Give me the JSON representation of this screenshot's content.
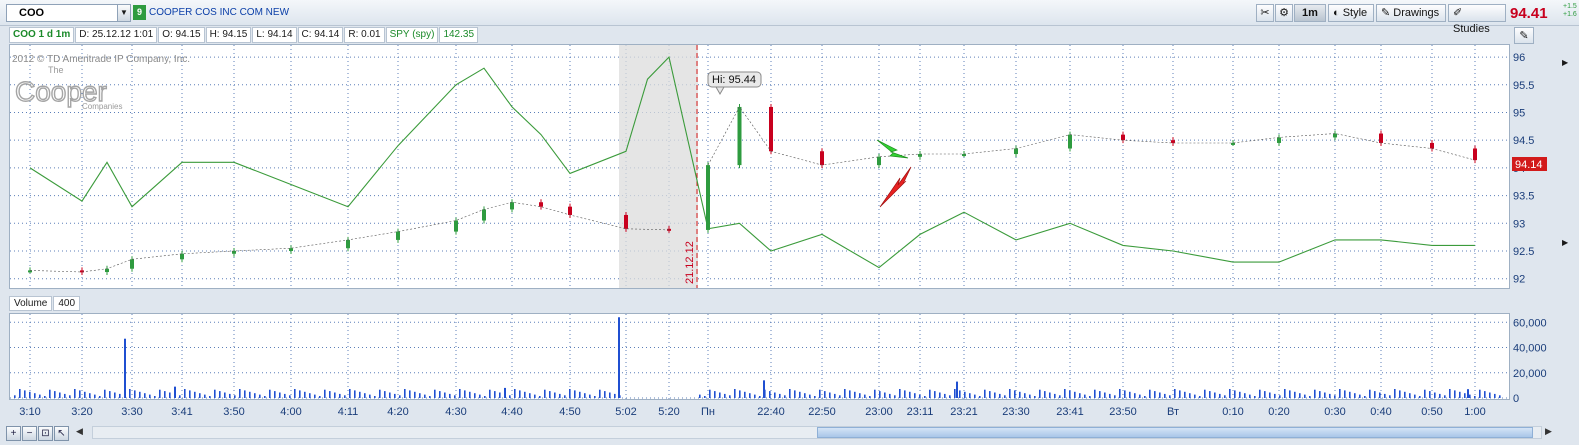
{
  "toolbar": {
    "symbol": "COO",
    "badge": "9",
    "company": "COOPER COS INC COM NEW",
    "buttons": {
      "period": "1m",
      "style": "Style",
      "drawings": "Drawings",
      "studies": "Studies"
    },
    "last_price": "94.41",
    "change_top": "+1.5",
    "change_bottom": "+1.6"
  },
  "info_bar": {
    "study": "COO 1 d 1m",
    "date": "D: 25.12.12 1:01",
    "open": "O: 94.15",
    "high": "H: 94.15",
    "low": "L: 94.14",
    "close": "C: 94.14",
    "range": "R: 0.01",
    "compare": "SPY (spy)",
    "compare_value": "142.35"
  },
  "watermark": {
    "copyright": "2012 © TD Ameritrade IP Company, Inc.",
    "logo_the": "The",
    "logo_main": "Cooper",
    "logo_sub": "Companies"
  },
  "volume_header": {
    "label": "Volume",
    "value": "400"
  },
  "colors": {
    "up": "#2e9b3f",
    "down": "#c8001e",
    "compare": "#3b9b3b",
    "volume": "#1f4fd1",
    "grid": "#5c7fb8"
  },
  "chart_data": [
    {
      "type": "candlestick",
      "title": "COO 1 d 1m",
      "ylim": [
        91.85,
        96.2
      ],
      "yticks": [
        92,
        92.5,
        93,
        93.5,
        94,
        94.5,
        95,
        95.5,
        96
      ],
      "grid": true,
      "x_ticks": [
        "3:10",
        "3:20",
        "3:30",
        "3:41",
        "3:50",
        "4:00",
        "4:11",
        "4:20",
        "4:30",
        "4:40",
        "4:50",
        "5:02",
        "5:20",
        "Пн",
        "22:40",
        "22:50",
        "23:00",
        "23:11",
        "23:21",
        "23:30",
        "23:41",
        "23:50",
        "Вт",
        "0:10",
        "0:20",
        "0:30",
        "0:40",
        "0:50",
        "1:00"
      ],
      "session_break_label": "21.12.12",
      "high_label": "Hi: 95.44",
      "last_marker": "94.14",
      "series": [
        {
          "name": "COO",
          "points": [
            [
              "3:10",
              92.15
            ],
            [
              "3:20",
              92.12
            ],
            [
              "3:25",
              92.18
            ],
            [
              "3:30",
              92.35
            ],
            [
              "3:41",
              92.45
            ],
            [
              "3:50",
              92.5
            ],
            [
              "4:00",
              92.55
            ],
            [
              "4:11",
              92.7
            ],
            [
              "4:20",
              92.85
            ],
            [
              "4:30",
              93.05
            ],
            [
              "4:35",
              93.25
            ],
            [
              "4:40",
              93.38
            ],
            [
              "4:45",
              93.3
            ],
            [
              "4:50",
              93.15
            ],
            [
              "5:02",
              92.9
            ],
            [
              "5:20",
              92.88
            ],
            [
              "Пн",
              94.05
            ],
            [
              "Пн+",
              95.1
            ],
            [
              "22:40",
              94.3
            ],
            [
              "22:50",
              94.05
            ],
            [
              "23:00",
              94.2
            ],
            [
              "23:11",
              94.25
            ],
            [
              "23:21",
              94.25
            ],
            [
              "23:30",
              94.35
            ],
            [
              "23:41",
              94.6
            ],
            [
              "23:50",
              94.5
            ],
            [
              "Вт",
              94.45
            ],
            [
              "0:10",
              94.45
            ],
            [
              "0:20",
              94.55
            ],
            [
              "0:30",
              94.62
            ],
            [
              "0:40",
              94.45
            ],
            [
              "0:50",
              94.35
            ],
            [
              "1:00",
              94.14
            ]
          ]
        },
        {
          "name": "SPY (spy)",
          "points": [
            [
              "3:10",
              94.0
            ],
            [
              "3:20",
              93.4
            ],
            [
              "3:25",
              94.1
            ],
            [
              "3:30",
              93.3
            ],
            [
              "3:41",
              94.1
            ],
            [
              "3:50",
              94.1
            ],
            [
              "4:00",
              93.7
            ],
            [
              "4:11",
              93.3
            ],
            [
              "4:20",
              94.4
            ],
            [
              "4:30",
              95.5
            ],
            [
              "4:35",
              95.8
            ],
            [
              "4:40",
              95.1
            ],
            [
              "4:45",
              94.6
            ],
            [
              "4:50",
              93.9
            ],
            [
              "5:02",
              94.3
            ],
            [
              "5:10",
              95.6
            ],
            [
              "5:20",
              96.0
            ],
            [
              "Пн",
              92.9
            ],
            [
              "Пн+",
              93.0
            ],
            [
              "22:40",
              92.5
            ],
            [
              "22:50",
              92.8
            ],
            [
              "23:00",
              92.2
            ],
            [
              "23:11",
              92.8
            ],
            [
              "23:21",
              93.2
            ],
            [
              "23:30",
              92.7
            ],
            [
              "23:41",
              93.0
            ],
            [
              "23:50",
              92.6
            ],
            [
              "Вт",
              92.5
            ],
            [
              "0:10",
              92.3
            ],
            [
              "0:20",
              92.3
            ],
            [
              "0:30",
              92.7
            ],
            [
              "0:40",
              92.7
            ],
            [
              "0:50",
              92.6
            ],
            [
              "1:00",
              92.6
            ]
          ]
        }
      ]
    },
    {
      "type": "bar",
      "title": "Volume",
      "ylim": [
        0,
        65000
      ],
      "yticks": [
        "0",
        "20,000",
        "40,000",
        "60,000"
      ],
      "grid": true,
      "spikes": [
        [
          "3:30",
          47000
        ],
        [
          "5:02",
          64000
        ],
        [
          "3:41",
          9000
        ],
        [
          "22:40",
          14000
        ],
        [
          "23:21",
          13000
        ],
        [
          "4:40",
          8000
        ],
        [
          "1:00",
          7000
        ]
      ]
    }
  ]
}
